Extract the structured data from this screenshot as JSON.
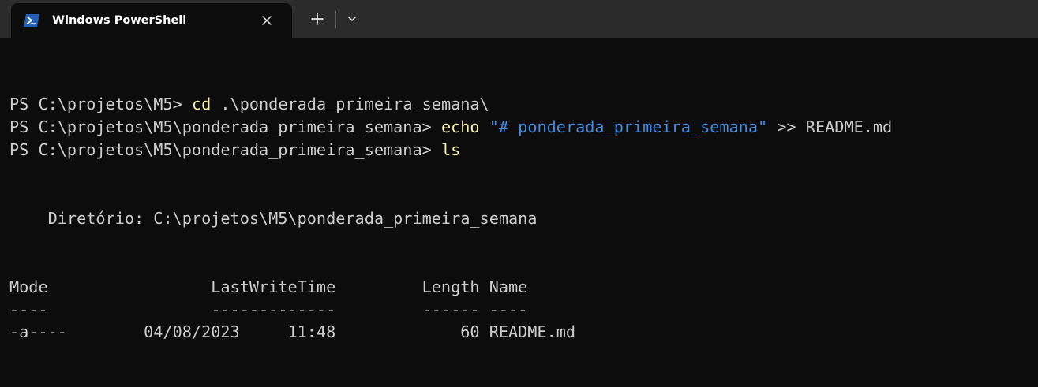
{
  "window": {
    "tab_title": "Windows PowerShell",
    "tab_icon": "powershell-icon",
    "close_icon": "close-icon",
    "new_tab_icon": "plus-icon",
    "dropdown_icon": "chevron-down-icon"
  },
  "colors": {
    "background": "#0c0c0c",
    "titlebar": "#2b2b2b",
    "text": "#cccccc",
    "command": "#f9f1a5",
    "string": "#3b8eea",
    "icon_blue": "#1f5fb8"
  },
  "terminal": {
    "line1": {
      "prompt": "PS C:\\projetos\\M5> ",
      "command": "cd",
      "args": " .\\ponderada_primeira_semana\\"
    },
    "line2": {
      "prompt": "PS C:\\projetos\\M5\\ponderada_primeira_semana> ",
      "command": "echo",
      "space": " ",
      "string": "\"# ponderada_primeira_semana\"",
      "rest": " >> README.md"
    },
    "line3": {
      "prompt": "PS C:\\projetos\\M5\\ponderada_primeira_semana> ",
      "command": "ls"
    },
    "directory_line": "    Diretório: C:\\projetos\\M5\\ponderada_primeira_semana",
    "header_line": "Mode                 LastWriteTime         Length Name",
    "separator_line": "----                 -------------         ------ ----",
    "row_line": "-a----        04/08/2023     11:48             60 README.md"
  }
}
